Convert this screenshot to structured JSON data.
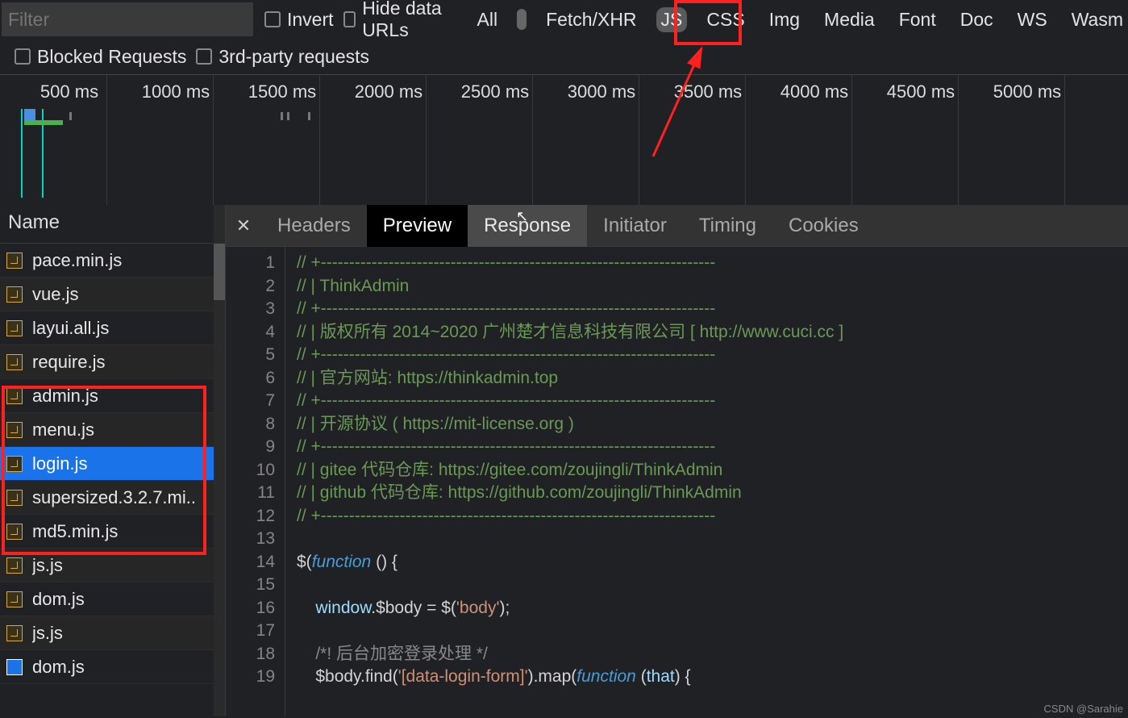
{
  "filter": {
    "placeholder": "Filter",
    "invert": "Invert",
    "hide_data_urls": "Hide data URLs",
    "blocked": "Blocked Requests",
    "third_party": "3rd-party requests",
    "types": [
      "All",
      "Fetch/XHR",
      "JS",
      "CSS",
      "Img",
      "Media",
      "Font",
      "Doc",
      "WS",
      "Wasm"
    ],
    "selected_type_index": 2
  },
  "timeline": {
    "ticks": [
      "500 ms",
      "1000 ms",
      "1500 ms",
      "2000 ms",
      "2500 ms",
      "3000 ms",
      "3500 ms",
      "4000 ms",
      "4500 ms",
      "5000 ms"
    ]
  },
  "sidebar": {
    "header": "Name",
    "files": [
      {
        "name": "pace.min.js"
      },
      {
        "name": "vue.js"
      },
      {
        "name": "layui.all.js"
      },
      {
        "name": "require.js"
      },
      {
        "name": "admin.js"
      },
      {
        "name": "menu.js"
      },
      {
        "name": "login.js"
      },
      {
        "name": "supersized.3.2.7.mi.."
      },
      {
        "name": "md5.min.js"
      },
      {
        "name": "js.js"
      },
      {
        "name": "dom.js"
      },
      {
        "name": "js.js"
      },
      {
        "name": "dom.js"
      }
    ],
    "selected_index": 6
  },
  "detail": {
    "tabs": [
      "Headers",
      "Preview",
      "Response",
      "Initiator",
      "Timing",
      "Cookies"
    ],
    "active_tab_index": 1,
    "hover_tab_index": 2
  },
  "code": {
    "lines": [
      "// +----------------------------------------------------------------------",
      "// | ThinkAdmin",
      "// +----------------------------------------------------------------------",
      "// | 版权所有 2014~2020 广州楚才信息科技有限公司 [ http://www.cuci.cc ]",
      "// +----------------------------------------------------------------------",
      "// | 官方网站: https://thinkadmin.top",
      "// +----------------------------------------------------------------------",
      "// | 开源协议 ( https://mit-license.org )",
      "// +----------------------------------------------------------------------",
      "// | gitee 代码仓库: https://gitee.com/zoujingli/ThinkAdmin",
      "// | github 代码仓库: https://github.com/zoujingli/ThinkAdmin",
      "// +----------------------------------------------------------------------",
      "",
      "$(function () {",
      "",
      "    window.$body = $('body');",
      "",
      "    /*! 后台加密登录处理 */",
      "    $body.find('[data-login-form]').map(function (that) {"
    ]
  },
  "watermark": "CSDN @Sarahie"
}
